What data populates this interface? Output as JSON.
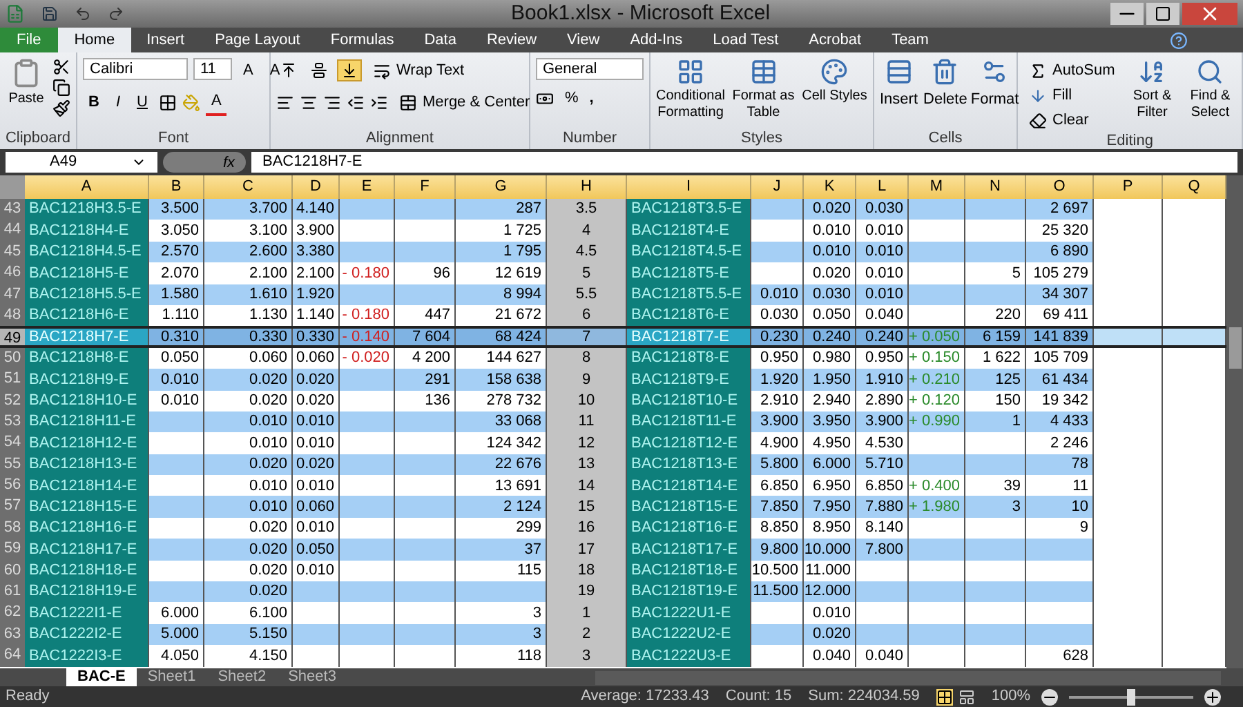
{
  "window": {
    "title": "Book1.xlsx - Microsoft Excel"
  },
  "ribbon_tabs": [
    {
      "label": "File",
      "kind": "file",
      "selected": false
    },
    {
      "label": "Home",
      "kind": "tab",
      "selected": true
    },
    {
      "label": "Insert",
      "kind": "tab",
      "selected": false
    },
    {
      "label": "Page Layout",
      "kind": "tab",
      "selected": false
    },
    {
      "label": "Formulas",
      "kind": "tab",
      "selected": false
    },
    {
      "label": "Data",
      "kind": "tab",
      "selected": false
    },
    {
      "label": "Review",
      "kind": "tab",
      "selected": false
    },
    {
      "label": "View",
      "kind": "tab",
      "selected": false
    },
    {
      "label": "Add-Ins",
      "kind": "tab",
      "selected": false
    },
    {
      "label": "Load Test",
      "kind": "tab",
      "selected": false
    },
    {
      "label": "Acrobat",
      "kind": "tab",
      "selected": false
    },
    {
      "label": "Team",
      "kind": "tab",
      "selected": false
    }
  ],
  "ribbon": {
    "clipboard": {
      "label": "Clipboard",
      "paste": "Paste"
    },
    "font": {
      "label": "Font",
      "name": "Calibri",
      "size": "11",
      "bold": "B",
      "italic": "I",
      "underline": "U",
      "color_letter": "A",
      "grow": "A",
      "shrink": "A"
    },
    "alignment": {
      "label": "Alignment",
      "vertical_align": [
        {
          "on": false
        },
        {
          "on": false
        },
        {
          "on": true
        }
      ],
      "wrap_text": "Wrap Text",
      "merge": "Merge & Center"
    },
    "number": {
      "label": "Number",
      "format": "General",
      "percent": "%",
      "comma": ","
    },
    "styles": {
      "label": "Styles",
      "buttons": [
        "Conditional Formatting",
        "Format as Table",
        "Cell Styles"
      ]
    },
    "cells": {
      "label": "Cells",
      "buttons": [
        "Insert",
        "Delete",
        "Format"
      ]
    },
    "editing": {
      "label": "Editing",
      "autosum": "AutoSum",
      "fill": "Fill",
      "clear": "Clear",
      "sort": "Sort & Filter",
      "find": "Find & Select"
    }
  },
  "formula_bar": {
    "name_box": "A49",
    "fx": "fx",
    "value": "BAC1218H7-E"
  },
  "columns": [
    "A",
    "B",
    "C",
    "D",
    "E",
    "F",
    "G",
    "H",
    "I",
    "J",
    "K",
    "L",
    "M",
    "N",
    "O",
    "P",
    "Q"
  ],
  "rows": [
    {
      "number": "43",
      "selected": false,
      "cells": {
        "A": "BAC1218H3.5-E",
        "B": "3.500",
        "C": "3.700",
        "D": "4.140",
        "G": "287",
        "H": "3.5",
        "I": "BAC1218T3.5-E",
        "K": "0.020",
        "L": "0.030",
        "O": "2 697"
      }
    },
    {
      "number": "44",
      "selected": false,
      "cells": {
        "A": "BAC1218H4-E",
        "B": "3.050",
        "C": "3.100",
        "D": "3.900",
        "G": "1 725",
        "H": "4",
        "I": "BAC1218T4-E",
        "K": "0.010",
        "L": "0.010",
        "O": "25 320"
      }
    },
    {
      "number": "45",
      "selected": false,
      "cells": {
        "A": "BAC1218H4.5-E",
        "B": "2.570",
        "C": "2.600",
        "D": "3.380",
        "G": "1 795",
        "H": "4.5",
        "I": "BAC1218T4.5-E",
        "K": "0.010",
        "L": "0.010",
        "O": "6 890"
      }
    },
    {
      "number": "46",
      "selected": false,
      "cells": {
        "A": "BAC1218H5-E",
        "B": "2.070",
        "C": "2.100",
        "D": "2.100",
        "E": "- 0.180",
        "F": "96",
        "G": "12 619",
        "H": "5",
        "I": "BAC1218T5-E",
        "K": "0.020",
        "L": "0.010",
        "N": "5",
        "O": "105 279"
      }
    },
    {
      "number": "47",
      "selected": false,
      "cells": {
        "A": "BAC1218H5.5-E",
        "B": "1.580",
        "C": "1.610",
        "D": "1.920",
        "G": "8 994",
        "H": "5.5",
        "I": "BAC1218T5.5-E",
        "J": "0.010",
        "K": "0.030",
        "L": "0.010",
        "O": "34 307"
      }
    },
    {
      "number": "48",
      "selected": false,
      "cells": {
        "A": "BAC1218H6-E",
        "B": "1.110",
        "C": "1.130",
        "D": "1.140",
        "E": "- 0.180",
        "F": "447",
        "G": "21 672",
        "H": "6",
        "I": "BAC1218T6-E",
        "J": "0.030",
        "K": "0.050",
        "L": "0.040",
        "N": "220",
        "O": "69 411"
      }
    },
    {
      "number": "49",
      "selected": true,
      "cells": {
        "A": "BAC1218H7-E",
        "B": "0.310",
        "C": "0.330",
        "D": "0.330",
        "E": "- 0.140",
        "F": "7 604",
        "G": "68 424",
        "H": "7",
        "I": "BAC1218T7-E",
        "J": "0.230",
        "K": "0.240",
        "L": "0.240",
        "M": "+ 0.050",
        "N": "6 159",
        "O": "141 839"
      }
    },
    {
      "number": "50",
      "selected": false,
      "cells": {
        "A": "BAC1218H8-E",
        "B": "0.050",
        "C": "0.060",
        "D": "0.060",
        "E": "- 0.020",
        "F": "4 200",
        "G": "144 627",
        "H": "8",
        "I": "BAC1218T8-E",
        "J": "0.950",
        "K": "0.980",
        "L": "0.950",
        "M": "+ 0.150",
        "N": "1 622",
        "O": "105 709"
      }
    },
    {
      "number": "51",
      "selected": false,
      "cells": {
        "A": "BAC1218H9-E",
        "B": "0.010",
        "C": "0.020",
        "D": "0.020",
        "F": "291",
        "G": "158 638",
        "H": "9",
        "I": "BAC1218T9-E",
        "J": "1.920",
        "K": "1.950",
        "L": "1.910",
        "M": "+ 0.210",
        "N": "125",
        "O": "61 434"
      }
    },
    {
      "number": "52",
      "selected": false,
      "cells": {
        "A": "BAC1218H10-E",
        "B": "0.010",
        "C": "0.020",
        "D": "0.020",
        "F": "136",
        "G": "278 732",
        "H": "10",
        "I": "BAC1218T10-E",
        "J": "2.910",
        "K": "2.940",
        "L": "2.890",
        "M": "+ 0.120",
        "N": "150",
        "O": "19 342"
      }
    },
    {
      "number": "53",
      "selected": false,
      "cells": {
        "A": "BAC1218H11-E",
        "C": "0.010",
        "D": "0.010",
        "G": "33 068",
        "H": "11",
        "I": "BAC1218T11-E",
        "J": "3.900",
        "K": "3.950",
        "L": "3.900",
        "M": "+ 0.990",
        "N": "1",
        "O": "4 433"
      }
    },
    {
      "number": "54",
      "selected": false,
      "cells": {
        "A": "BAC1218H12-E",
        "C": "0.010",
        "D": "0.010",
        "G": "124 342",
        "H": "12",
        "I": "BAC1218T12-E",
        "J": "4.900",
        "K": "4.950",
        "L": "4.530",
        "O": "2 246"
      }
    },
    {
      "number": "55",
      "selected": false,
      "cells": {
        "A": "BAC1218H13-E",
        "C": "0.020",
        "D": "0.020",
        "G": "22 676",
        "H": "13",
        "I": "BAC1218T13-E",
        "J": "5.800",
        "K": "6.000",
        "L": "5.710",
        "O": "78"
      }
    },
    {
      "number": "56",
      "selected": false,
      "cells": {
        "A": "BAC1218H14-E",
        "C": "0.010",
        "D": "0.010",
        "G": "13 691",
        "H": "14",
        "I": "BAC1218T14-E",
        "J": "6.850",
        "K": "6.950",
        "L": "6.850",
        "M": "+ 0.400",
        "N": "39",
        "O": "11"
      }
    },
    {
      "number": "57",
      "selected": false,
      "cells": {
        "A": "BAC1218H15-E",
        "C": "0.010",
        "D": "0.060",
        "G": "2 124",
        "H": "15",
        "I": "BAC1218T15-E",
        "J": "7.850",
        "K": "7.950",
        "L": "7.880",
        "M": "+ 1.980",
        "N": "3",
        "O": "10"
      }
    },
    {
      "number": "58",
      "selected": false,
      "cells": {
        "A": "BAC1218H16-E",
        "C": "0.020",
        "D": "0.010",
        "G": "299",
        "H": "16",
        "I": "BAC1218T16-E",
        "J": "8.850",
        "K": "8.950",
        "L": "8.140",
        "O": "9"
      }
    },
    {
      "number": "59",
      "selected": false,
      "cells": {
        "A": "BAC1218H17-E",
        "C": "0.020",
        "D": "0.050",
        "G": "37",
        "H": "17",
        "I": "BAC1218T17-E",
        "J": "9.800",
        "K": "10.000",
        "L": "7.800"
      }
    },
    {
      "number": "60",
      "selected": false,
      "cells": {
        "A": "BAC1218H18-E",
        "C": "0.020",
        "D": "0.010",
        "G": "115",
        "H": "18",
        "I": "BAC1218T18-E",
        "J": "10.500",
        "K": "11.000"
      }
    },
    {
      "number": "61",
      "selected": false,
      "cells": {
        "A": "BAC1218H19-E",
        "C": "0.020",
        "H": "19",
        "I": "BAC1218T19-E",
        "J": "11.500",
        "K": "12.000"
      }
    },
    {
      "number": "62",
      "selected": false,
      "cells": {
        "A": "BAC1222I1-E",
        "B": "6.000",
        "C": "6.100",
        "G": "3",
        "H": "1",
        "I": "BAC1222U1-E",
        "K": "0.010"
      }
    },
    {
      "number": "63",
      "selected": false,
      "cells": {
        "A": "BAC1222I2-E",
        "B": "5.000",
        "C": "5.150",
        "G": "3",
        "H": "2",
        "I": "BAC1222U2-E",
        "K": "0.020"
      }
    },
    {
      "number": "64",
      "selected": false,
      "cells": {
        "A": "BAC1222I3-E",
        "B": "4.050",
        "C": "4.150",
        "G": "118",
        "H": "3",
        "I": "BAC1222U3-E",
        "K": "0.040",
        "L": "0.040",
        "O": "628"
      }
    }
  ],
  "sheet_tabs": [
    {
      "label": "BAC-E",
      "selected": true
    },
    {
      "label": "Sheet1",
      "selected": false
    },
    {
      "label": "Sheet2",
      "selected": false
    },
    {
      "label": "Sheet3",
      "selected": false
    }
  ],
  "status_bar": {
    "mode": "Ready",
    "average": "Average: 17233.43",
    "count": "Count: 15",
    "sum": "Sum: 224034.59",
    "zoom": "100%",
    "zoom_slider": {
      "level": 0.5
    }
  }
}
